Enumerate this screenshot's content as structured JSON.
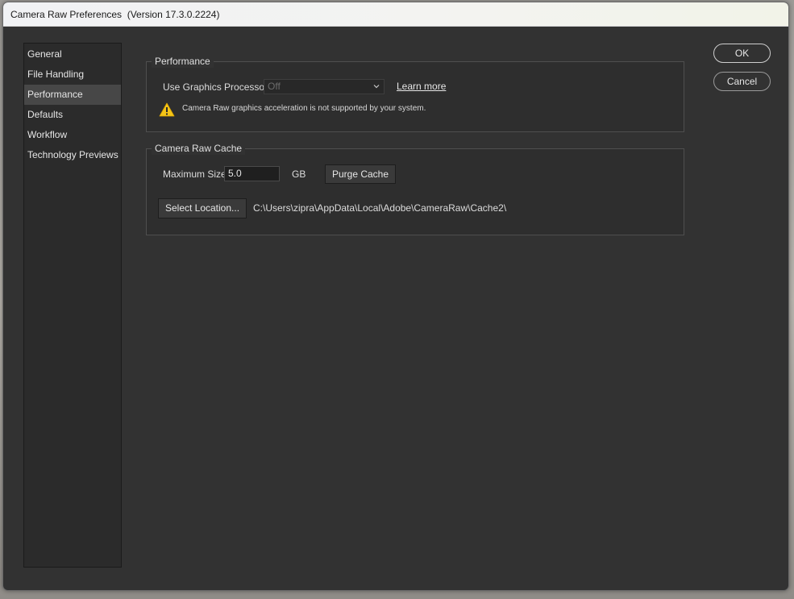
{
  "window": {
    "title": "Camera Raw Preferences  (Version 17.3.0.2224)"
  },
  "sidebar": {
    "items": [
      {
        "label": "General",
        "selected": false
      },
      {
        "label": "File Handling",
        "selected": false
      },
      {
        "label": "Performance",
        "selected": true
      },
      {
        "label": "Defaults",
        "selected": false
      },
      {
        "label": "Workflow",
        "selected": false
      },
      {
        "label": "Technology Previews",
        "selected": false
      }
    ]
  },
  "performance": {
    "legend": "Performance",
    "gpu_label": "Use Graphics Processor:",
    "gpu_value": "Off",
    "learn_more": "Learn more",
    "warning": "Camera Raw graphics acceleration is not supported by your system.",
    "warning_icon": "warning-triangle-icon"
  },
  "cache": {
    "legend": "Camera Raw Cache",
    "max_size_label": "Maximum Size:",
    "max_size_value": "5.0",
    "unit": "GB",
    "purge_button": "Purge Cache",
    "select_location_button": "Select Location...",
    "path": "C:\\Users\\zipra\\AppData\\Local\\Adobe\\CameraRaw\\Cache2\\"
  },
  "actions": {
    "ok": "OK",
    "cancel": "Cancel"
  },
  "colors": {
    "panel": "#323232",
    "warning": "#f5c518",
    "sidebar_selected": "#474747"
  }
}
